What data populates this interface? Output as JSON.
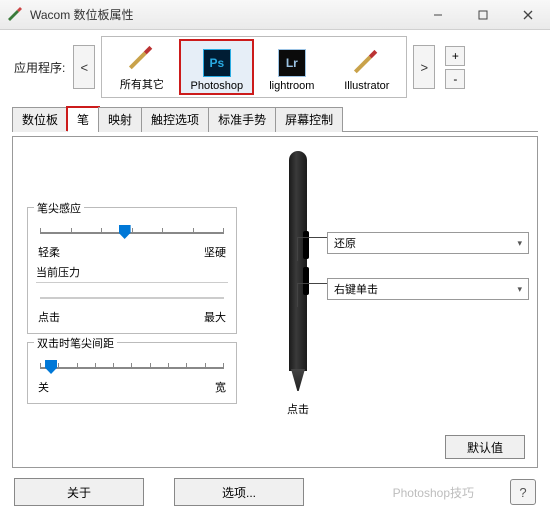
{
  "title": "Wacom 数位板属性",
  "app_label": "应用程序:",
  "apps": {
    "all_other": "所有其它",
    "photoshop": "Photoshop",
    "lightroom": "lightroom",
    "illustrator": "Illustrator"
  },
  "nav": {
    "prev": "<",
    "next": ">",
    "plus": "+",
    "minus": "-"
  },
  "tabs": {
    "tablet": "数位板",
    "pen": "笔",
    "eraser": "映射",
    "touchopts": "触控选项",
    "gesture": "标准手势",
    "screenctrl": "屏幕控制"
  },
  "tip": {
    "header": "笔尖感应",
    "soft": "轻柔",
    "firm": "坚硬",
    "pressure_header": "当前压力",
    "click": "点击",
    "max": "最大"
  },
  "dbl": {
    "header": "双击时笔尖间距",
    "off": "关",
    "wide": "宽"
  },
  "pen_actions": {
    "upper": "还原",
    "lower": "右键单击",
    "tip_label": "点击"
  },
  "defaults": "默认值",
  "about": "关于",
  "options": "选项...",
  "watermark": "Photoshop技巧"
}
